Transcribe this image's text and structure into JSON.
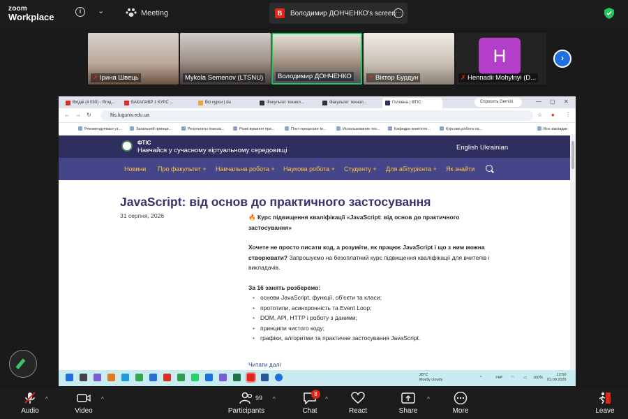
{
  "app": {
    "logo_line1": "zoom",
    "logo_line2": "Workplace",
    "meeting_label": "Meeting",
    "screen_share_badge": "B",
    "screen_share_label": "Володимир ДОНЧЕНКО's screen",
    "accent": "#22c55e"
  },
  "participants": [
    {
      "name": "Ірина Швець",
      "muted": true
    },
    {
      "name": "Mykola Semenov (LTSNU)",
      "muted": false
    },
    {
      "name": "Володимир ДОНЧЕНКО",
      "muted": false
    },
    {
      "name": "Віктор Бурдун",
      "muted": true
    },
    {
      "name": "Hennadii Mohylnyi  (D...",
      "muted": true,
      "avatar_letter": "H"
    }
  ],
  "browser": {
    "tabs": [
      "Вхідні (4 030) - Ягод...",
      "БАКАЛАВР 1 КУРС ...",
      "Всі курси | du",
      "Факультет технол...",
      "Факультет технол...",
      "Головна | ФТІС"
    ],
    "gemini_label": "Спросить Gemini",
    "url": "ftis.luguniv.edu.ua",
    "bookmarks": [
      "Рекомендуемые уз...",
      "Загальний принци...",
      "Результаты поиска...",
      "Розві вування при...",
      "Пост-процесинг м...",
      "Использование тех...",
      "Кафедра комп'юте...",
      "Курсова робота на..."
    ],
    "all_bookmarks": "Все закладки"
  },
  "site": {
    "name": "ФТІС",
    "tagline": "Навчайся у сучасному віртуальному середовищі",
    "lang_en": "English",
    "lang_uk": "Ukrainian",
    "nav": [
      "Новини",
      "Про факультет +",
      "Навчальна робота +",
      "Наукова робота +",
      "Студенту +",
      "Для абітурієнта +",
      "Як знайти"
    ]
  },
  "article": {
    "title": "JavaScript: від основ до практичного застосування",
    "date": "31 серпня, 2026",
    "intro": "🔥 Курс підвищення кваліфікації «JavaScript: від основ до практичного застосування»",
    "question_bold": "Хочете не просто писати код, а розуміти, як працює JavaScript і що з ним можна створювати?",
    "question_rest": " Запрошуємо на безоплатний курс підвищення кваліфікації для вчителів і викладачів.",
    "list_heading": "За 16 занять розберемо:",
    "list": [
      "основи JavaScript, функції, об'єкти та класи;",
      "прототипи, асинхронність та Event Loop;",
      "DOM, API, HTTP і роботу з даними;",
      "принципи чистого коду;",
      "графіки, алгоритми та практичне застосування JavaScript."
    ],
    "read_more": "Читати далі"
  },
  "taskbar": {
    "weather_temp": "28°C",
    "weather_desc": "Mostly cloudy",
    "lang": "УКР",
    "battery": "100%",
    "time": "12:50",
    "date": "01.09.2026"
  },
  "toolbar": {
    "audio": "Audio",
    "video": "Video",
    "participants": "Participants",
    "participants_count": "99",
    "chat": "Chat",
    "chat_count": "8",
    "react": "React",
    "share": "Share",
    "more": "More",
    "leave": "Leave"
  }
}
